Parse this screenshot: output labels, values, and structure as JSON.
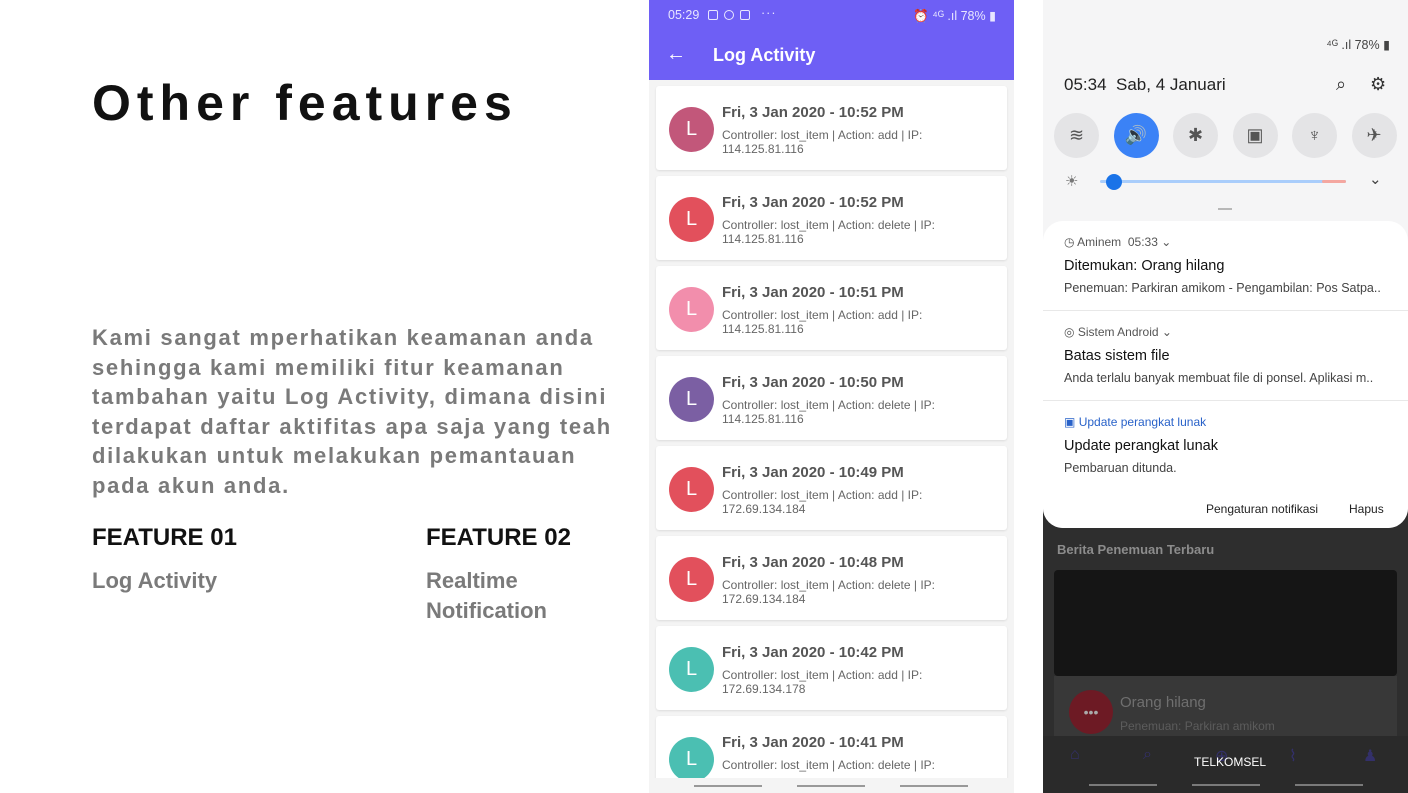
{
  "slide": {
    "title": "Other features",
    "body": "Kami sangat mperhatikan keamanan anda sehingga kami memiliki fitur keamanan tambahan yaitu Log Activity, dimana disini terdapat daftar aktifitas apa saja yang teah dilakukan untuk melakukan pemantauan pada akun anda.",
    "feature1": {
      "heading": "FEATURE 01",
      "description": "Log Activity"
    },
    "feature2": {
      "heading": "FEATURE 02",
      "description": "Realtime Notification"
    }
  },
  "log_app": {
    "status_time": "05:29",
    "status_icons": [
      "laptop-icon",
      "play-icon",
      "gallery-icon"
    ],
    "status_more": "···",
    "status_battery": "78%",
    "title": "Log Activity",
    "back_icon": "arrow-left-icon",
    "entries": [
      {
        "avatar": "L",
        "color": "#c2577a",
        "date": "Fri, 3 Jan 2020 - 10:52 PM",
        "detail": "Controller: lost_item | Action: add | IP: 114.125.81.116"
      },
      {
        "avatar": "L",
        "color": "#e2505c",
        "date": "Fri, 3 Jan 2020 - 10:52 PM",
        "detail": "Controller: lost_item | Action: delete | IP: 114.125.81.116"
      },
      {
        "avatar": "L",
        "color": "#f28eac",
        "date": "Fri, 3 Jan 2020 - 10:51 PM",
        "detail": "Controller: lost_item | Action: add | IP: 114.125.81.116"
      },
      {
        "avatar": "L",
        "color": "#7b5fa3",
        "date": "Fri, 3 Jan 2020 - 10:50 PM",
        "detail": "Controller: lost_item | Action: delete | IP: 114.125.81.116"
      },
      {
        "avatar": "L",
        "color": "#e2505c",
        "date": "Fri, 3 Jan 2020 - 10:49 PM",
        "detail": "Controller: lost_item | Action: add | IP: 172.69.134.184"
      },
      {
        "avatar": "L",
        "color": "#e2505c",
        "date": "Fri, 3 Jan 2020 - 10:48 PM",
        "detail": "Controller: lost_item | Action: delete | IP: 172.69.134.184"
      },
      {
        "avatar": "L",
        "color": "#4bbfb2",
        "date": "Fri, 3 Jan 2020 - 10:42 PM",
        "detail": "Controller: lost_item | Action: add | IP: 172.69.134.178"
      },
      {
        "avatar": "L",
        "color": "#4bbfb2",
        "date": "Fri, 3 Jan 2020 - 10:41 PM",
        "detail": "Controller: lost_item | Action: delete | IP:"
      }
    ]
  },
  "shade": {
    "status_network": "⁴ᴳ .ıl",
    "status_battery": "78%",
    "time": "05:34",
    "date": "Sab, 4 Januari",
    "search_icon": "search-icon",
    "settings_icon": "gear-icon",
    "quick_settings": [
      {
        "name": "wifi",
        "icon": "wifi-icon",
        "glyph": "≋",
        "on": false
      },
      {
        "name": "sound",
        "icon": "volume-icon",
        "glyph": "🔊",
        "on": true
      },
      {
        "name": "bluetooth",
        "icon": "bluetooth-icon",
        "glyph": "✱",
        "on": false
      },
      {
        "name": "rotation",
        "icon": "lock-icon",
        "glyph": "▣",
        "on": false
      },
      {
        "name": "flashlight",
        "icon": "flashlight-icon",
        "glyph": "♆",
        "on": false
      },
      {
        "name": "airplane",
        "icon": "airplane-icon",
        "glyph": "✈",
        "on": false
      }
    ],
    "brightness_level": 0.05,
    "notifications": [
      {
        "app": "Aminem",
        "time": "05:33",
        "title": "Ditemukan: Orang hilang",
        "text": "Penemuan: Parkiran amikom - Pengambilan: Pos Satpa..",
        "icon": "clock-icon"
      },
      {
        "app": "Sistem Android",
        "time": "",
        "title": "Batas sistem file",
        "text": "Anda terlalu banyak membuat file di ponsel. Aplikasi m..",
        "icon": "android-icon"
      },
      {
        "app": "Update perangkat lunak",
        "time": "",
        "title": "Update perangkat lunak",
        "text": "Pembaruan ditunda.",
        "icon": "update-icon"
      }
    ],
    "actions": {
      "settings": "Pengaturan notifikasi",
      "clear": "Hapus"
    }
  },
  "background_app": {
    "heading": "Berita Penemuan Terbaru",
    "card_title": "Orang hilang",
    "card_sub": "Penemuan: Parkiran amikom",
    "carrier": "TELKOMSEL"
  },
  "colors": {
    "primary": "#6e5ff5",
    "accent_blue": "#3b82f6"
  }
}
